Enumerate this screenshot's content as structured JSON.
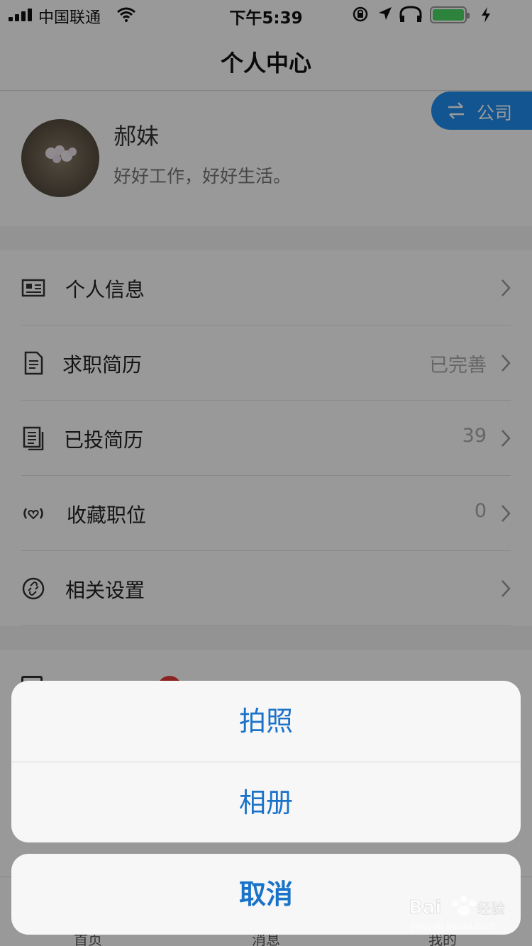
{
  "status_bar": {
    "carrier": "中国联通",
    "time": "下午5:39",
    "battery_level": 1.0,
    "battery_color": "#4cd964"
  },
  "nav": {
    "title": "个人中心"
  },
  "profile": {
    "name": "郝妹",
    "motto": "好好工作，好好生活。",
    "switch_label": "公司",
    "switch_icon": "swap-icon"
  },
  "menu": [
    {
      "label": "个人信息",
      "value": "",
      "icon": "id-card-icon"
    },
    {
      "label": "求职简历",
      "value": "已完善",
      "icon": "document-icon"
    },
    {
      "label": "已投简历",
      "value": "39",
      "icon": "documents-icon"
    },
    {
      "label": "收藏职位",
      "value": "0",
      "icon": "heart-signal-icon"
    },
    {
      "label": "相关设置",
      "value": "",
      "icon": "settings-link-icon"
    }
  ],
  "tabs": [
    "首页",
    "消息",
    "我的"
  ],
  "action_sheet": {
    "options": [
      "拍照",
      "相册"
    ],
    "cancel": "取消"
  },
  "colors": {
    "accent": "#1f8ef0",
    "sheet_text": "#1a73c9",
    "badge": "#e83b3b"
  }
}
